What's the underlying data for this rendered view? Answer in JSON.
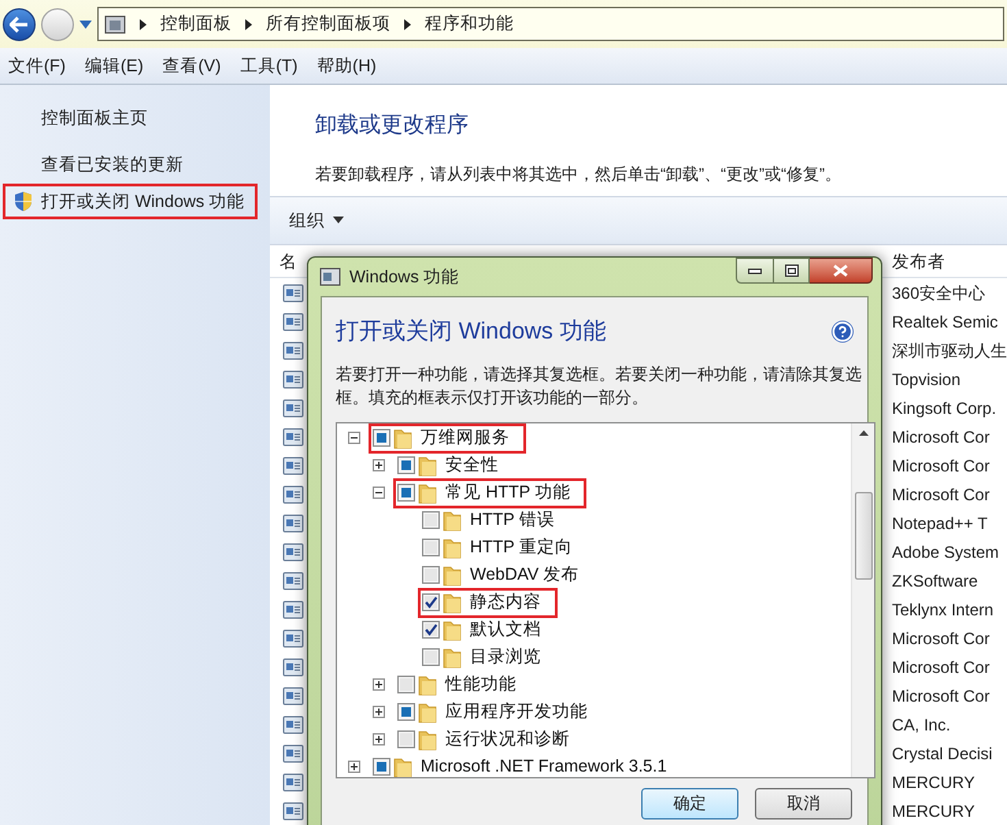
{
  "breadcrumb": [
    "控制面板",
    "所有控制面板项",
    "程序和功能"
  ],
  "menu": [
    "文件(F)",
    "编辑(E)",
    "查看(V)",
    "工具(T)",
    "帮助(H)"
  ],
  "sidebar": {
    "items": [
      {
        "label": "控制面板主页",
        "kind": "link",
        "highlighted": false
      },
      {
        "label": "查看已安装的更新",
        "kind": "link",
        "highlighted": false
      },
      {
        "label": "打开或关闭 Windows 功能",
        "kind": "shield",
        "highlighted": true
      }
    ]
  },
  "main": {
    "title": "卸载或更改程序",
    "description": "若要卸载程序，请从列表中将其选中，然后单击“卸载”、“更改”或“修复”。"
  },
  "toolbar": {
    "organize": "组织"
  },
  "table": {
    "columns": [
      "名",
      "发布者"
    ],
    "rows": [
      {
        "publisher": "360安全中心"
      },
      {
        "publisher": "Realtek Semic"
      },
      {
        "publisher": "深圳市驱动人生"
      },
      {
        "publisher": "Topvision"
      },
      {
        "publisher": "Kingsoft Corp."
      },
      {
        "publisher": "Microsoft Cor"
      },
      {
        "publisher": "Microsoft Cor"
      },
      {
        "publisher": "Microsoft Cor"
      },
      {
        "publisher": "Notepad++ T"
      },
      {
        "publisher": "Adobe System"
      },
      {
        "publisher": "ZKSoftware"
      },
      {
        "publisher": "Teklynx Intern"
      },
      {
        "publisher": "Microsoft Cor"
      },
      {
        "publisher": "Microsoft Cor"
      },
      {
        "publisher": "Microsoft Cor"
      },
      {
        "publisher": "CA, Inc."
      },
      {
        "publisher": "Crystal Decisi"
      },
      {
        "publisher": "MERCURY"
      },
      {
        "publisher": "MERCURY"
      }
    ]
  },
  "dialog": {
    "title": "Windows 功能",
    "heading": "打开或关闭 Windows 功能",
    "description": "若要打开一种功能，请选择其复选框。若要关闭一种功能，请清除其复选框。填充的框表示仅打开该功能的一部分。",
    "tree": [
      {
        "label": "万维网服务",
        "checked": false,
        "partial": true,
        "expanded": true,
        "highlighted": true,
        "children": [
          {
            "label": "安全性",
            "checked": false,
            "partial": true,
            "expanded": false,
            "highlighted": false
          },
          {
            "label": "常见 HTTP 功能",
            "checked": false,
            "partial": true,
            "expanded": true,
            "highlighted": true,
            "children": [
              {
                "label": "HTTP 错误",
                "checked": false,
                "partial": false,
                "highlighted": false
              },
              {
                "label": "HTTP 重定向",
                "checked": false,
                "partial": false,
                "highlighted": false
              },
              {
                "label": "WebDAV 发布",
                "checked": false,
                "partial": false,
                "highlighted": false
              },
              {
                "label": "静态内容",
                "checked": true,
                "partial": false,
                "highlighted": true
              },
              {
                "label": "默认文档",
                "checked": true,
                "partial": false,
                "highlighted": false
              },
              {
                "label": "目录浏览",
                "checked": false,
                "partial": false,
                "highlighted": false
              }
            ]
          },
          {
            "label": "性能功能",
            "checked": false,
            "partial": false,
            "expanded": false,
            "highlighted": false
          },
          {
            "label": "应用程序开发功能",
            "checked": false,
            "partial": true,
            "expanded": false,
            "highlighted": false
          },
          {
            "label": "运行状况和诊断",
            "checked": false,
            "partial": false,
            "expanded": false,
            "highlighted": false
          }
        ]
      },
      {
        "label": "Microsoft .NET Framework 3.5.1",
        "checked": false,
        "partial": true,
        "expanded": false,
        "highlighted": false
      }
    ],
    "buttons": [
      "确定",
      "取消"
    ]
  }
}
